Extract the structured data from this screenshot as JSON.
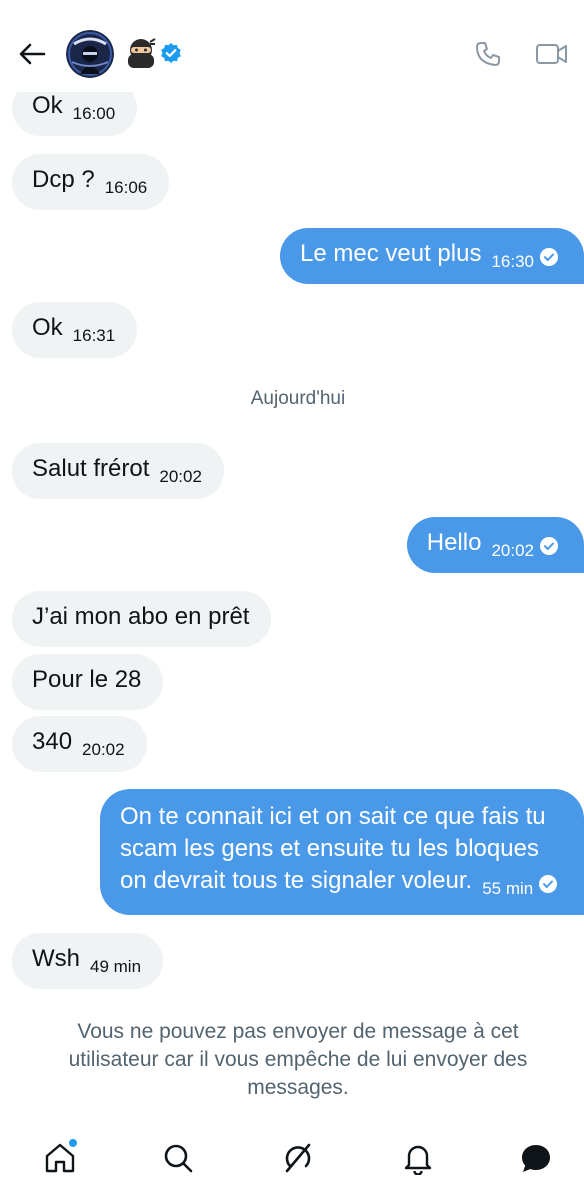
{
  "header": {
    "ninja_emoji": "🥷"
  },
  "messages": {
    "m1": {
      "text": "Ok",
      "time": "16:00"
    },
    "m2": {
      "text": "Dcp ?",
      "time": "16:06"
    },
    "m3": {
      "text": "Le mec veut plus",
      "time": "16:30"
    },
    "m4": {
      "text": "Ok",
      "time": "16:31"
    },
    "date_separator": "Aujourd'hui",
    "m5": {
      "text": "Salut frérot",
      "time": "20:02"
    },
    "m6": {
      "text": "Hello",
      "time": "20:02"
    },
    "m7": {
      "text": "J’ai mon abo en prêt"
    },
    "m8": {
      "text": "Pour le 28"
    },
    "m9": {
      "text": "340",
      "time": "20:02"
    },
    "m10": {
      "line1": "On te connait ici et on sait ce que fais tu",
      "line2": "scam les gens et ensuite tu les bloques",
      "line3": "on devrait tous te signaler voleur.",
      "time": "55 min"
    },
    "m11": {
      "text": "Wsh",
      "time": "49 min"
    }
  },
  "blocked_notice": "Vous ne pouvez pas envoyer de message à cet utilisateur car il vous empêche de lui envoyer des messages.",
  "colors": {
    "accent": "#1d9bf0",
    "outgoing_bubble": "#4a99e9",
    "incoming_bubble": "#eff3f4",
    "secondary_text": "#536471"
  },
  "icons": {
    "back": "back-arrow-icon",
    "call": "phone-icon",
    "video": "video-camera-icon",
    "home": "home-icon",
    "search": "search-icon",
    "grok": "grok-icon",
    "notifications": "bell-icon",
    "messages": "messages-icon"
  }
}
